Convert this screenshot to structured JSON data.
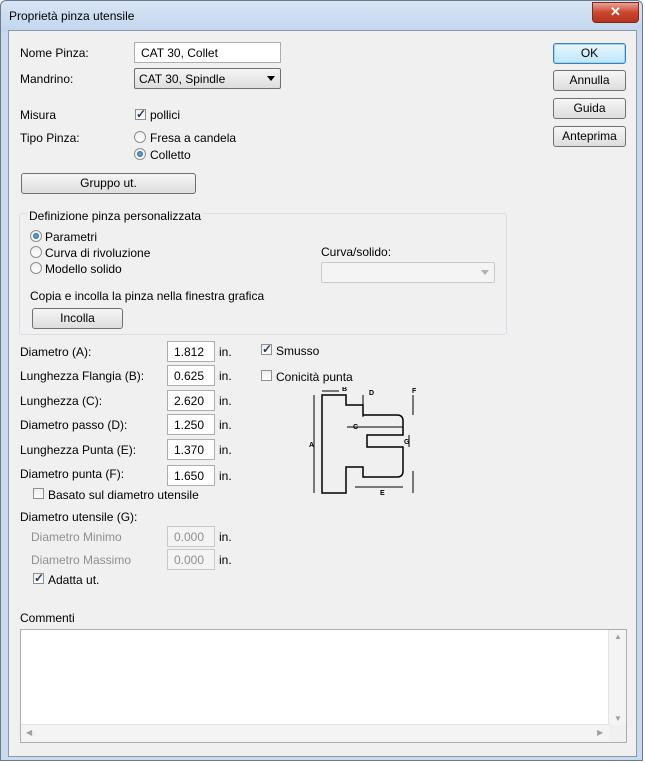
{
  "window": {
    "title": "Proprietà pinza utensile",
    "close_glyph": "✕"
  },
  "buttons": {
    "ok": "OK",
    "cancel": "Annulla",
    "help": "Guida",
    "preview": "Anteprima",
    "tool_group": "Gruppo ut.",
    "paste": "Incolla"
  },
  "form": {
    "name_label": "Nome Pinza:",
    "name_value": "CAT 30, Collet",
    "spindle_label": "Mandrino:",
    "spindle_value": "CAT 30, Spindle",
    "measure_label": "Misura",
    "inches_label": "pollici",
    "inches_checked": true,
    "type_label": "Tipo Pinza:",
    "type_options": [
      "Fresa a candela",
      "Colletto"
    ],
    "type_selected": "Colletto"
  },
  "custom_group": {
    "title": "Definizione pinza personalizzata",
    "options": [
      "Parametri",
      "Curva di rivoluzione",
      "Modello solido"
    ],
    "selected": "Parametri",
    "curve_label": "Curva/solido:",
    "curve_value": "",
    "copy_paste_text": "Copia e incolla la pinza nella finestra grafica"
  },
  "params": [
    {
      "label": "Diametro (A):",
      "value": "1.812",
      "unit": "in."
    },
    {
      "label": "Lunghezza Flangia (B):",
      "value": "0.625",
      "unit": "in."
    },
    {
      "label": "Lunghezza (C):",
      "value": "2.620",
      "unit": "in."
    },
    {
      "label": "Diametro passo (D):",
      "value": "1.250",
      "unit": "in."
    },
    {
      "label": "Lunghezza Punta (E):",
      "value": "1.370",
      "unit": "in."
    },
    {
      "label": "Diametro punta (F):",
      "value": "1.650",
      "unit": "in."
    }
  ],
  "chamfer": {
    "label": "Smusso",
    "checked": true
  },
  "taper": {
    "label": "Conicità punta",
    "checked": false
  },
  "based_on_tool": {
    "label": "Basato sul diametro utensile",
    "checked": false
  },
  "tool_diameter": {
    "label": "Diametro utensile (G):",
    "min_label": "Diametro Minimo",
    "min_value": "0.000",
    "max_label": "Diametro Massimo",
    "max_value": "0.000",
    "unit": "in."
  },
  "fit_tool": {
    "label": "Adatta ut.",
    "checked": true
  },
  "comments": {
    "label": "Commenti",
    "value": ""
  },
  "diagram_labels": {
    "a": "A",
    "b": "B",
    "c": "C",
    "d": "D",
    "e": "E",
    "f": "F",
    "g": "G"
  }
}
